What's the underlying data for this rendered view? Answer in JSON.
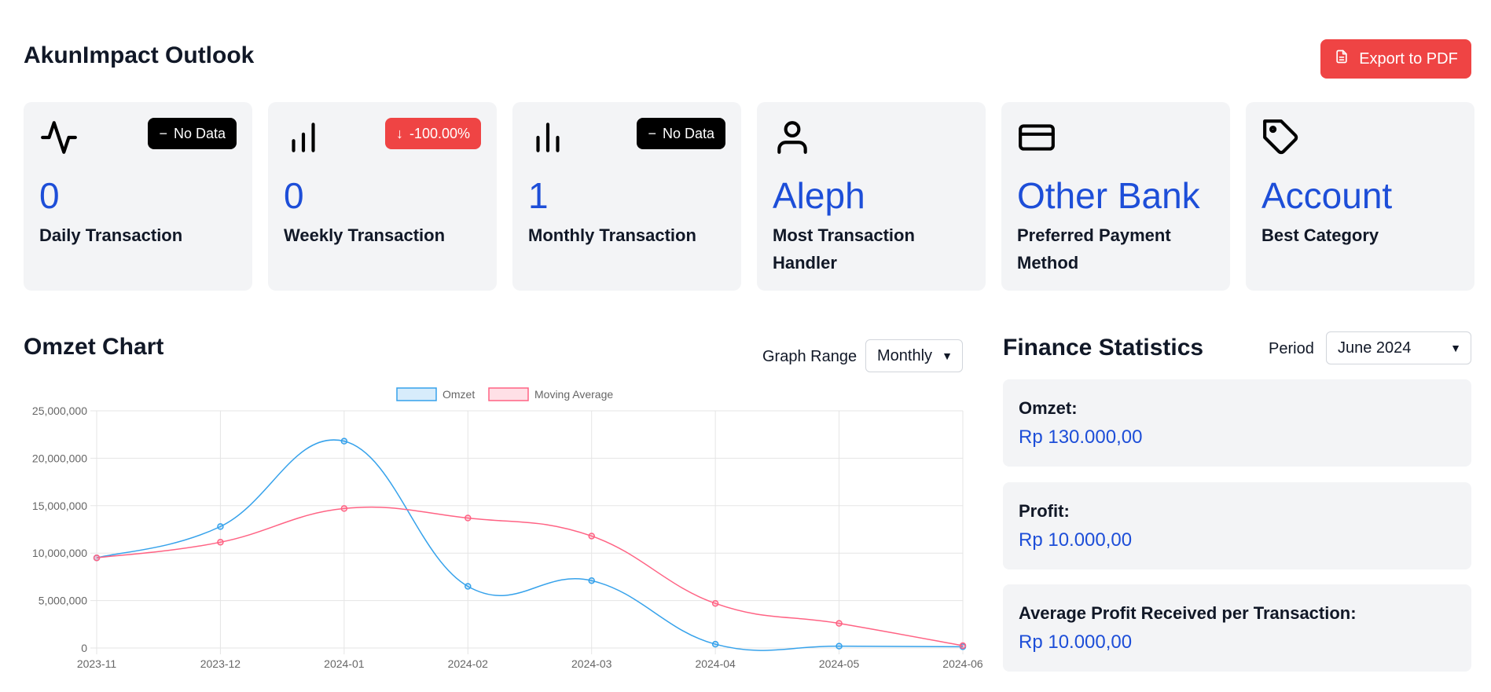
{
  "header": {
    "title": "AkunImpact Outlook",
    "export_label": "Export to PDF"
  },
  "cards": [
    {
      "value": "0",
      "label": "Daily Transaction",
      "badge": "No Data",
      "badge_type": "neutral",
      "icon": "activity-icon"
    },
    {
      "value": "0",
      "label": "Weekly Transaction",
      "badge": "-100.00%",
      "badge_type": "down",
      "icon": "bar-chart-icon"
    },
    {
      "value": "1",
      "label": "Monthly Transaction",
      "badge": "No Data",
      "badge_type": "neutral",
      "icon": "bar-chart-alt-icon"
    },
    {
      "value": "Aleph",
      "label": "Most Transaction Handler",
      "icon": "user-icon"
    },
    {
      "value": "Other Bank",
      "label": "Preferred Payment Method",
      "icon": "credit-card-icon"
    },
    {
      "value": "Account",
      "label": "Best Category",
      "icon": "tag-icon"
    }
  ],
  "omzet_chart": {
    "title": "Omzet Chart",
    "range_label": "Graph Range",
    "range_value": "Monthly"
  },
  "finance": {
    "title": "Finance Statistics",
    "period_label": "Period",
    "period_value": "June 2024",
    "stats": [
      {
        "label": "Omzet:",
        "value": "Rp 130.000,00"
      },
      {
        "label": "Profit:",
        "value": "Rp 10.000,00"
      },
      {
        "label": "Average Profit Received per Transaction:",
        "value": "Rp 10.000,00"
      }
    ]
  },
  "colors": {
    "accent_blue": "#1d4ed8",
    "export_red": "#ef4444",
    "omzet_line": "#36a2eb",
    "moving_avg_line": "#ff6384"
  },
  "chart_data": {
    "type": "line",
    "categories": [
      "2023-11",
      "2023-12",
      "2024-01",
      "2024-02",
      "2024-03",
      "2024-04",
      "2024-05",
      "2024-06"
    ],
    "series": [
      {
        "name": "Omzet",
        "values": [
          9500000,
          12800000,
          21800000,
          6500000,
          7100000,
          400000,
          200000,
          130000
        ]
      },
      {
        "name": "Moving Average",
        "values": [
          9500000,
          11150000,
          14700000,
          13700000,
          11800000,
          4700000,
          2600000,
          250000
        ]
      }
    ],
    "y_ticks": [
      "0",
      "5,000,000",
      "10,000,000",
      "15,000,000",
      "20,000,000",
      "25,000,000"
    ],
    "ylim": [
      0,
      25000000
    ],
    "grid": true,
    "legend": "top-center"
  }
}
